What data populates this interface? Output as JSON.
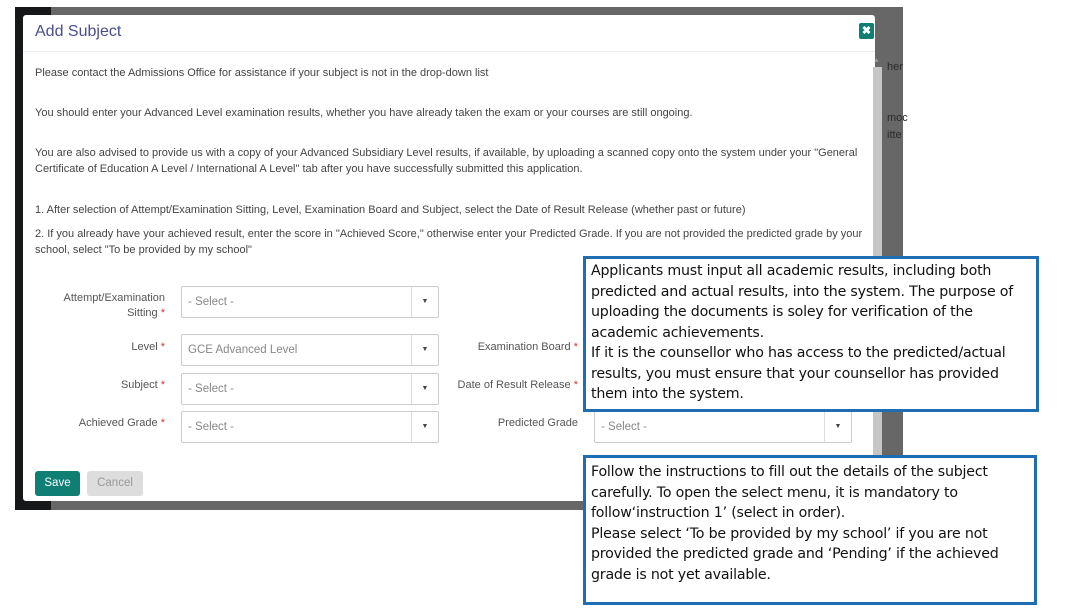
{
  "modal": {
    "title": "Add Subject",
    "close_icon": "close-icon",
    "paragraphs": [
      "Please contact the Admissions Office for assistance if your subject is not in the drop-down list",
      "You should enter your Advanced Level examination results, whether you have already taken the exam or your courses are still ongoing.",
      "You are also advised to provide us with a copy of your Advanced Subsidiary Level results, if available, by uploading a scanned copy onto the system under your \"General Certificate of Education A Level / International A Level\" tab after you have successfully submitted this application.",
      "1. After selection of Attempt/Examination Sitting, Level, Examination Board and Subject, select the Date of Result Release (whether past or future)",
      "2. If you already have your achieved result, enter the score in \"Achieved Score,\" otherwise enter your Predicted Grade. If you are not provided the predicted grade by your school, select \"To be provided by my school\""
    ],
    "fields": {
      "attempt": {
        "label1": "Attempt/Examination",
        "label2": "Sitting",
        "value": "- Select -"
      },
      "level": {
        "label": "Level",
        "value": "GCE Advanced Level"
      },
      "board": {
        "label": "Examination Board"
      },
      "subject": {
        "label": "Subject",
        "value": "- Select -"
      },
      "release": {
        "label": "Date of Result Release"
      },
      "achieved": {
        "label": "Achieved Grade",
        "value": "- Select -"
      },
      "predicted": {
        "label": "Predicted Grade",
        "value": "- Select -"
      }
    },
    "required_mark": "*",
    "save": "Save",
    "cancel": "Cancel",
    "accent": "#0f7f74"
  },
  "background_text": [
    "her",
    "moc",
    "itte"
  ],
  "callouts": [
    "Applicants must input all academic results, including both predicted and actual results, into the system. The purpose of uploading the documents is soley for verification of the academic achievements.\nIf it is the counsellor who has access to the predicted/actual results, you must ensure that your counsellor has provided them into the system.",
    "Follow the instructions to fill out the details of the subject carefully. To open the select menu, it is mandatory to follow‘instruction 1’ (select in order).\nPlease select ‘To be provided by my school’ if you are not provided the predicted grade and ‘Pending’ if the achieved grade is not yet available."
  ]
}
